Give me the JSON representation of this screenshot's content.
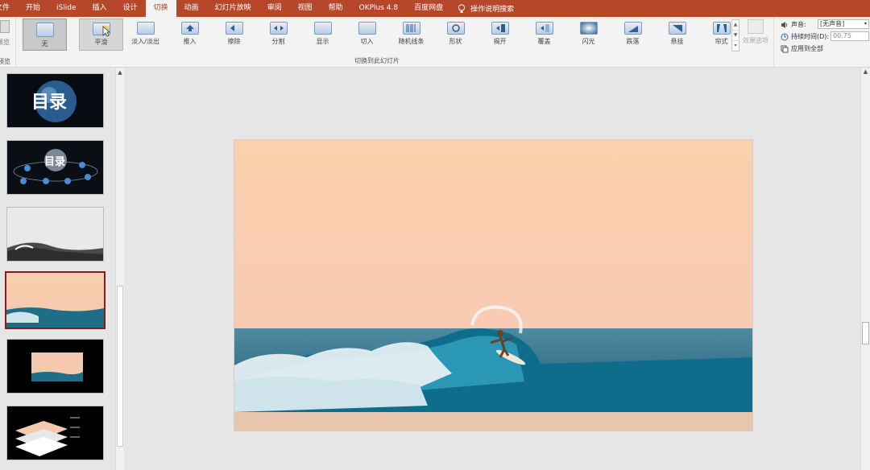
{
  "menu": {
    "tabs": [
      "文件",
      "开始",
      "iSlide",
      "插入",
      "设计",
      "切换",
      "动画",
      "幻灯片放映",
      "审阅",
      "视图",
      "帮助",
      "OKPlus 4.8",
      "百度网盘"
    ],
    "active_index": 5,
    "tell_me": "操作说明搜索"
  },
  "ribbon": {
    "preview_label": "预览",
    "preview_group": "预览",
    "group_label": "切换到此幻灯片",
    "effects": [
      "无",
      "平滑",
      "淡入/淡出",
      "推入",
      "擦除",
      "分割",
      "显示",
      "切入",
      "随机线条",
      "形状",
      "揭开",
      "覆盖",
      "闪光",
      "跌落",
      "悬挂",
      "帘式"
    ],
    "selected_index": 0,
    "hover_index": 1,
    "effect_options_label": "效果选项",
    "sound_label": "声音:",
    "sound_value": "[无声音]",
    "duration_label": "持续时间(D):",
    "duration_value": "00.75",
    "apply_all_label": "应用到全部"
  },
  "slides": {
    "selected_index": 3,
    "items": [
      {
        "kind": "catalog-earth",
        "title": "目录"
      },
      {
        "kind": "catalog-orbit",
        "title": "目录"
      },
      {
        "kind": "wave-gray"
      },
      {
        "kind": "wave-color"
      },
      {
        "kind": "wave-small"
      },
      {
        "kind": "layers"
      }
    ]
  },
  "colors": {
    "accent": "#b7472a",
    "selection": "#8c1a1a"
  }
}
